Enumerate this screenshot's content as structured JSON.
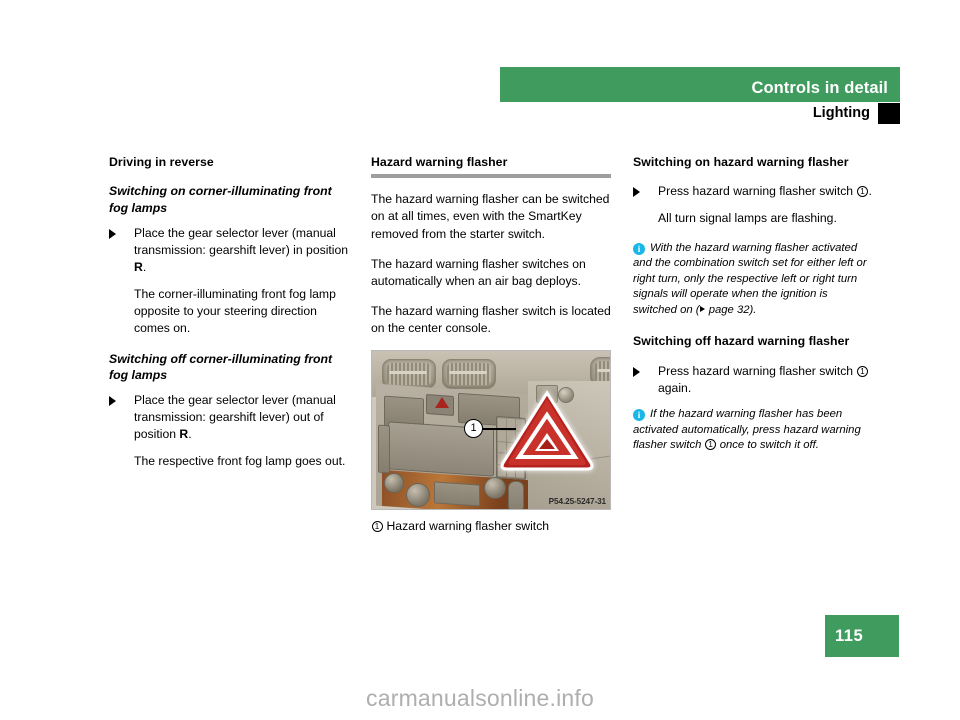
{
  "header": {
    "chapter_title": "Controls in detail",
    "section_title": "Lighting",
    "bar_color": "#3f9b5e"
  },
  "columns": {
    "left": {
      "section_heading": "Driving in reverse",
      "sub_heading_1": "Switching on corner-illuminating front fog lamps",
      "bullet_1_pre": "Place the gear selector lever (manual transmission: gearshift lever) in position ",
      "bullet_1_bold": "R",
      "bullet_1_post": ".",
      "para_1": "The corner-illuminating front fog lamp opposite to your steering direction comes on.",
      "sub_heading_2": "Switching off corner-illuminating front fog lamps",
      "bullet_2_pre": "Place the gear selector lever (manual transmission: gearshift lever) out of position ",
      "bullet_2_bold": "R",
      "bullet_2_post": ".",
      "para_2": "The respective front fog lamp goes out."
    },
    "middle": {
      "section_heading": "Hazard warning flasher",
      "para_1": "The hazard warning flasher can be switched on at all times, even with the SmartKey removed from the starter switch.",
      "para_2": "The hazard warning flasher switches on automatically when an air bag deploys.",
      "para_3": "The hazard warning flasher switch is located on the center console.",
      "figure": {
        "code": "P54.25-5247-31",
        "callout_number": "1",
        "caption_number": "1",
        "caption_text": "Hazard warning flasher switch"
      }
    },
    "right": {
      "section_heading_1": "Switching on hazard warning flasher",
      "bullet_1_pre": "Press hazard warning flasher switch ",
      "bullet_1_ref": "1",
      "bullet_1_post": ".",
      "para_1": "All turn signal lamps are flashing.",
      "note_1_text": "With the hazard warning flasher activated and the combination switch set for either left or right turn, only the respective left or right turn signals will operate when the ignition is switched on (",
      "note_1_pageref": " page 32).",
      "section_heading_2": "Switching off hazard warning flasher",
      "bullet_2_pre": "Press hazard warning flasher switch ",
      "bullet_2_ref": "1",
      "bullet_2_post": " again.",
      "note_2_pre": "If the hazard warning flasher has been activated automatically, press hazard warning flasher switch ",
      "note_2_ref": "1",
      "note_2_post": " once to switch it off."
    }
  },
  "footer": {
    "page_number": "115",
    "watermark": "carmanualsonline.info"
  }
}
